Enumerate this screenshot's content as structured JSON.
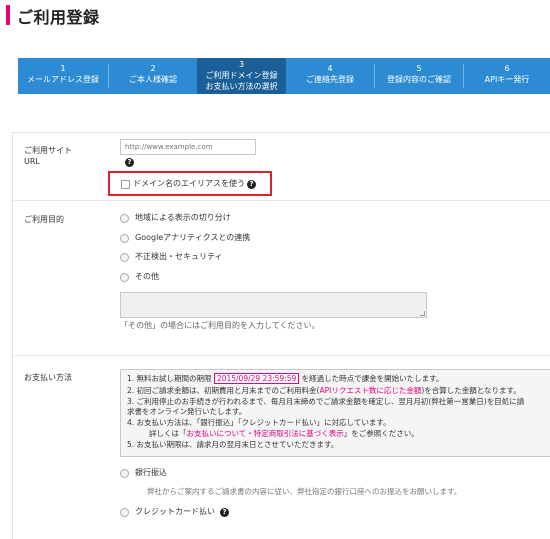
{
  "page": {
    "title": "ご利用登録"
  },
  "steps": [
    {
      "num": "1",
      "line1": "メールアドレス登録",
      "line2": ""
    },
    {
      "num": "2",
      "line1": "ご本人様確認",
      "line2": ""
    },
    {
      "num": "3",
      "line1": "ご利用ドメイン登録",
      "line2": "お支払い方法の選択"
    },
    {
      "num": "4",
      "line1": "ご連絡先登録",
      "line2": ""
    },
    {
      "num": "5",
      "line1": "登録内容のご確認",
      "line2": ""
    },
    {
      "num": "6",
      "line1": "APIキー発行",
      "line2": ""
    }
  ],
  "active_step": 3,
  "site_url": {
    "label_line1": "ご利用サイト",
    "label_line2": "URL",
    "placeholder": "http://www.example.com",
    "alias_checkbox_label": "ドメイン名のエイリアスを使う"
  },
  "purpose": {
    "label": "ご利用目的",
    "options": [
      "地域による表示の切り分け",
      "Googleアナリティクスとの連携",
      "不正検出・セキュリティ",
      "その他"
    ],
    "hint": "「その他」の場合にはご利用目的を入力してください。"
  },
  "payment": {
    "label": "お支払い方法",
    "notes": {
      "l1_a": "1. 無料お試し期間の期限",
      "l1_date": "2015/09/29 23:59:59",
      "l1_b": "を経過した時点で課金を開始いたします。",
      "l2_a": "2. 初回ご請求金額は、初期費用と月末までのご利用料金(",
      "l2_red": "APIリクエスト数に応じた金額",
      "l2_b": ")を合算した金額となります。",
      "l3": "3. ご利用停止のお手続きが行われるまで、毎月月末締めでご請求金額を確定し、翌月月初(弊社第一営業日)を目処に請",
      "l3b": "求書をオンライン発行いたします。",
      "l4": "4. お支払い方法は、「銀行振込」「クレジットカード払い」に対応しています。",
      "l4b_a": "詳しくは「",
      "l4b_red": "お支払いについて・特定商取引法に基づく表示",
      "l4b_b": "」をご参照ください。",
      "l5": "5. お支払い期限は、請求月の翌月末日とさせていただきます。"
    },
    "bank_label": "銀行振込",
    "bank_note": "弊社からご案内するご請求書の内容に従い、弊社指定の銀行口座へのお振込をお願いします。",
    "card_label": "クレジットカード払い"
  },
  "colors": {
    "accent": "#e4007f",
    "step_bg": "#2d8bd3",
    "step_active": "#1a5f98",
    "highlight_border": "#d9232d"
  }
}
